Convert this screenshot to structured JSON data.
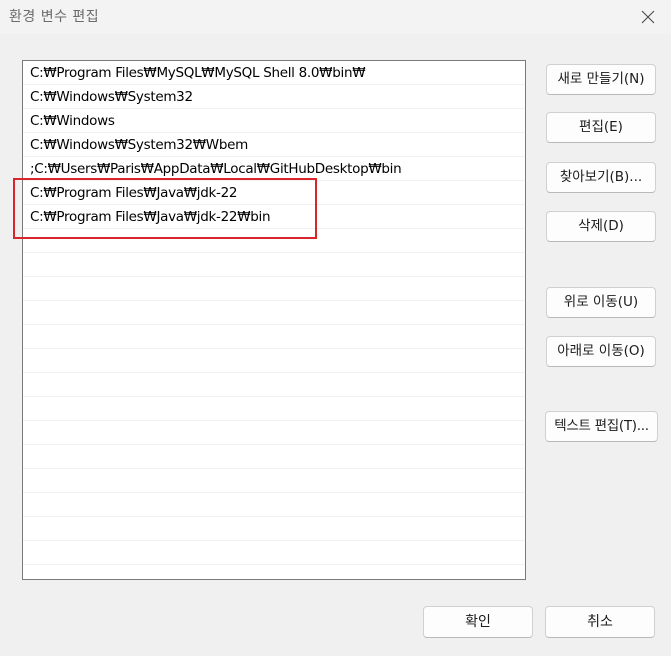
{
  "window": {
    "title": "환경 변수 편집"
  },
  "path_list": {
    "rows": [
      "C:₩Program Files₩MySQL₩MySQL Shell 8.0₩bin₩",
      "C:₩Windows₩System32",
      "C:₩Windows",
      "C:₩Windows₩System32₩Wbem",
      ";C:₩Users₩Paris₩AppData₩Local₩GitHubDesktop₩bin",
      "C:₩Program Files₩Java₩jdk-22",
      "C:₩Program Files₩Java₩jdk-22₩bin",
      "",
      "",
      "",
      "",
      "",
      "",
      "",
      "",
      "",
      "",
      "",
      "",
      "",
      "",
      ""
    ]
  },
  "buttons": {
    "new": "새로 만들기(N)",
    "edit": "편집(E)",
    "browse": "찾아보기(B)...",
    "delete": "삭제(D)",
    "move_up": "위로 이동(U)",
    "move_down": "아래로 이동(O)",
    "edit_text": "텍스트 편집(T)..."
  },
  "footer": {
    "ok": "확인",
    "cancel": "취소"
  },
  "colors": {
    "highlight_border": "#d8262c",
    "dialog_bg": "#f0f0f0"
  },
  "icons": {
    "close": "close-icon"
  }
}
